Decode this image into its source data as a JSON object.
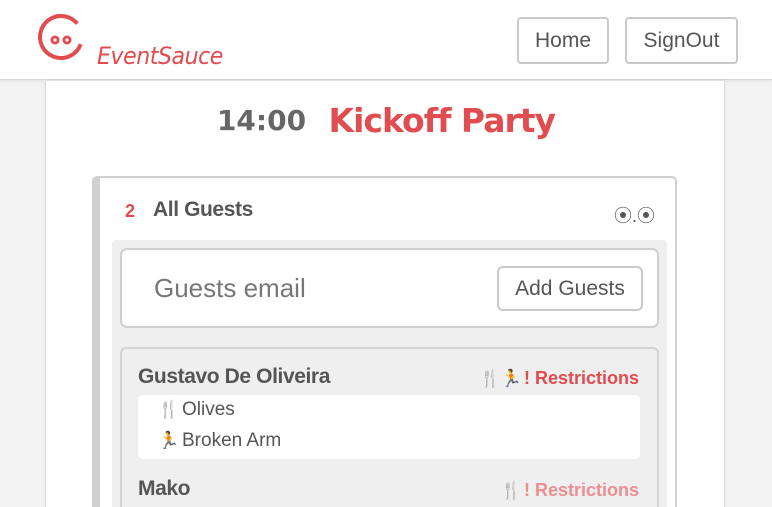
{
  "header": {
    "brand": "EventSauce",
    "nav": {
      "home_label": "Home",
      "signout_label": "SignOut"
    },
    "brand_color": "#e04c4f"
  },
  "event": {
    "time": "14:00",
    "name": "Kickoff Party"
  },
  "guests_panel": {
    "count": "2",
    "title": "All Guests",
    "toggle_icon": "⦿.⦿",
    "email_placeholder": "Guests email",
    "email_value": "",
    "add_button_label": "Add Guests",
    "guests": [
      {
        "name": "Gustavo De Oliveira",
        "restriction_icons": "🍴🏃",
        "restrictions_label": "! Restrictions",
        "details": [
          {
            "icon": "fork-knife-icon",
            "glyph": "🍴",
            "text": "Olives"
          },
          {
            "icon": "running-person-icon",
            "glyph": "🏃",
            "text": "Broken Arm"
          }
        ]
      },
      {
        "name": "Mako",
        "restriction_icons": "🍴",
        "restrictions_label": "! Restrictions",
        "details": []
      }
    ]
  },
  "colors": {
    "accent": "#e04c4f",
    "accent_faded": "#ec8f91",
    "text": "#555555",
    "border": "#d0d0d0",
    "panel_bg": "#efefef"
  }
}
